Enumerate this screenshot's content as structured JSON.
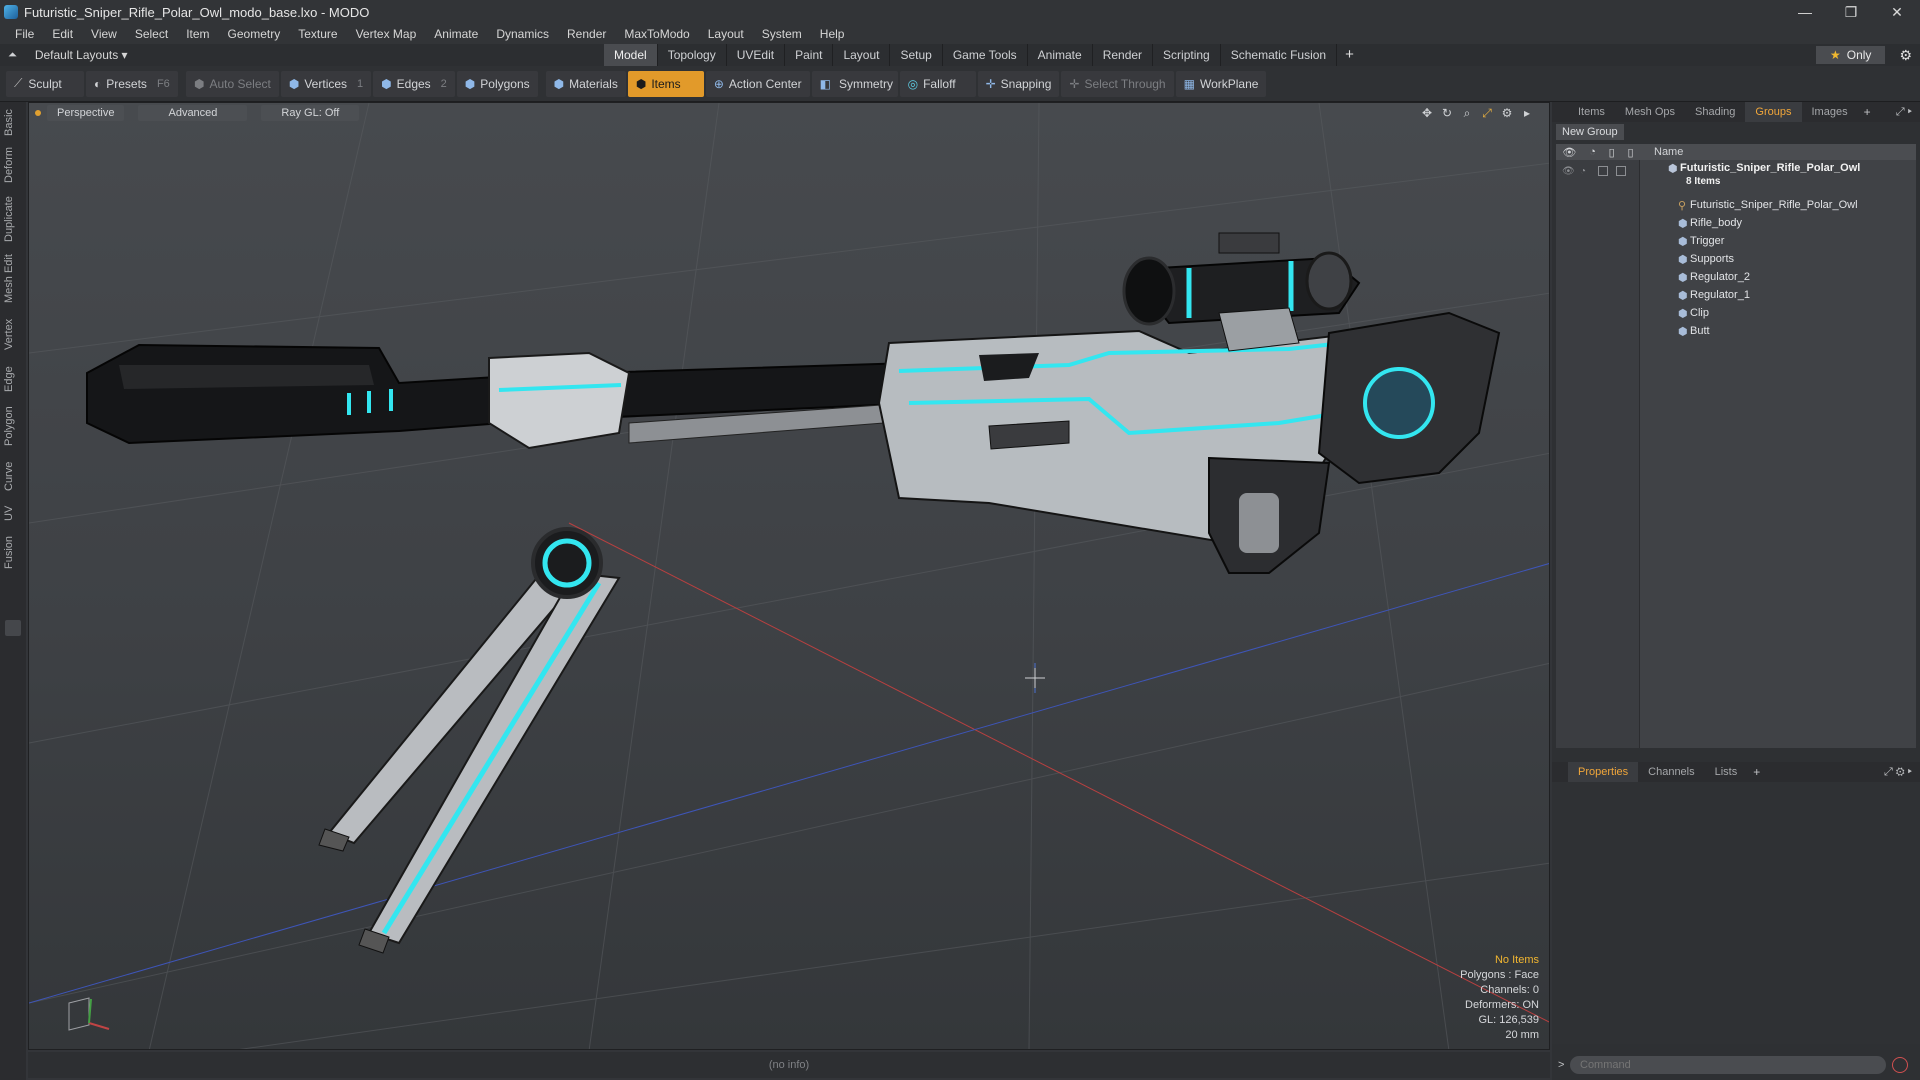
{
  "window": {
    "title": "Futuristic_Sniper_Rifle_Polar_Owl_modo_base.lxo - MODO",
    "minimize": "—",
    "maximize": "❐",
    "close": "✕"
  },
  "menu": [
    "File",
    "Edit",
    "View",
    "Select",
    "Item",
    "Geometry",
    "Texture",
    "Vertex Map",
    "Animate",
    "Dynamics",
    "Render",
    "MaxToModo",
    "Layout",
    "System",
    "Help"
  ],
  "layout": {
    "dropdown": "Default Layouts ▾",
    "tabs": [
      "Model",
      "Topology",
      "UVEdit",
      "Paint",
      "Layout",
      "Setup",
      "Game Tools",
      "Animate",
      "Render",
      "Scripting",
      "Schematic Fusion"
    ],
    "active_tab": "Model",
    "add_tab": "+",
    "only_label": "Only"
  },
  "toolbar": {
    "sculpt": "Sculpt",
    "presets": "Presets",
    "presets_key": "F6",
    "auto_select": "Auto Select",
    "vertices": "Vertices",
    "vertices_key": "1",
    "edges": "Edges",
    "edges_key": "2",
    "polygons": "Polygons",
    "materials": "Materials",
    "items": "Items",
    "action_center": "Action Center",
    "symmetry": "Symmetry",
    "falloff": "Falloff",
    "snapping": "Snapping",
    "select_through": "Select Through",
    "workplane": "WorkPlane"
  },
  "left_tabs": [
    "Basic",
    "Deform",
    "Duplicate",
    "Mesh Edit",
    "Vertex",
    "Edge",
    "Polygon",
    "Curve",
    "UV",
    "Fusion"
  ],
  "viewport": {
    "view": "Perspective",
    "mode": "Advanced",
    "raygl": "Ray GL: Off",
    "info": {
      "items": "No Items",
      "polygons": "Polygons : Face",
      "channels": "Channels: 0",
      "deformers": "Deformers: ON",
      "gl": "GL: 126,539",
      "size": "20 mm"
    }
  },
  "status": "(no info)",
  "right_panel": {
    "tabs": [
      "Items",
      "Mesh Ops",
      "Shading",
      "Groups",
      "Images"
    ],
    "active_tab": "Groups",
    "add": "+",
    "new_group": "New Group",
    "column_name": "Name",
    "root": "Futuristic_Sniper_Rifle_Polar_Owl",
    "root_count": "8 Items",
    "children": [
      "Futuristic_Sniper_Rifle_Polar_Owl",
      "Rifle_body",
      "Trigger",
      "Supports",
      "Regulator_2",
      "Regulator_1",
      "Clip",
      "Butt"
    ],
    "prop_tabs": [
      "Properties",
      "Channels",
      "Lists"
    ],
    "prop_active": "Properties",
    "command_placeholder": "Command",
    "prompt": ">"
  },
  "colors": {
    "accent": "#f0a63a",
    "glow": "#33e6f0",
    "active_tool": "#e29a2a"
  }
}
